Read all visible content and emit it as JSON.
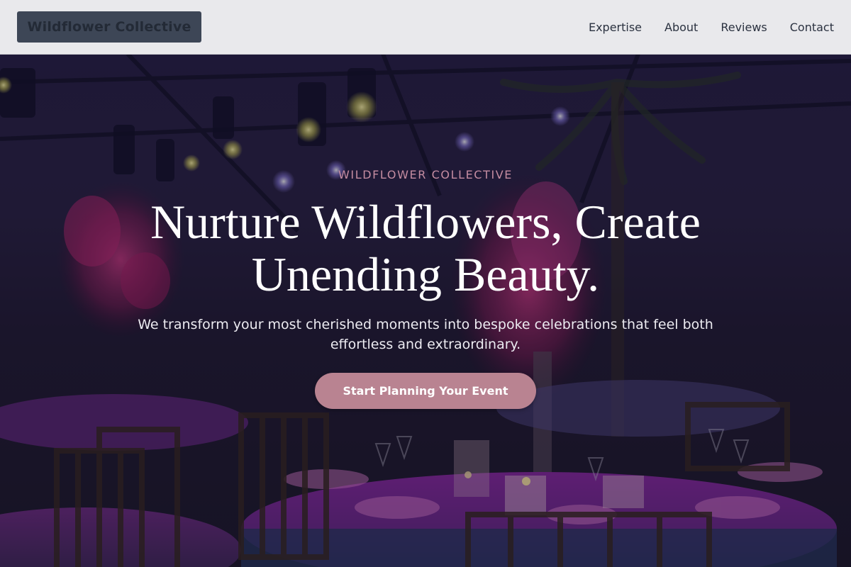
{
  "header": {
    "logo_text": "Wildflower Collective",
    "nav": [
      {
        "label": "Expertise"
      },
      {
        "label": "About"
      },
      {
        "label": "Reviews"
      },
      {
        "label": "Contact"
      }
    ]
  },
  "hero": {
    "eyebrow": "WILDFLOWER COLLECTIVE",
    "headline": "Nurture Wildflowers, Create Unending Beauty.",
    "subtext": "We transform your most cherished moments into bespoke celebrations that feel both effortless and extraordinary.",
    "cta_label": "Start Planning Your Event"
  },
  "colors": {
    "header_bg": "#e9e9ec",
    "logo_bg": "#3d4656",
    "accent": "#b98391",
    "eyebrow": "#c48ca1",
    "hero_overlay": "#1a1530"
  }
}
